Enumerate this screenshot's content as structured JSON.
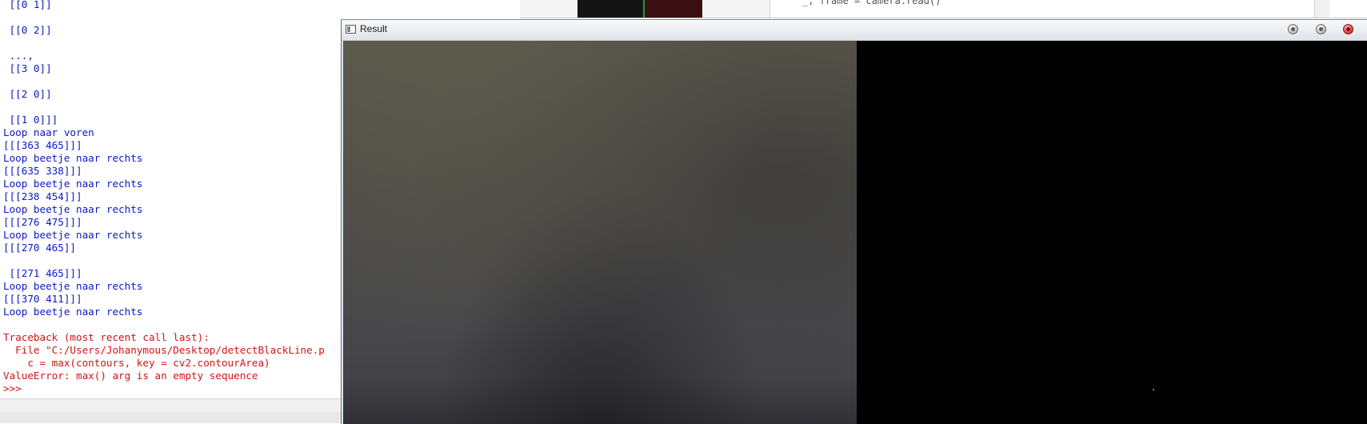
{
  "shell": {
    "output_lines": [
      {
        "text": " [[0 1]]",
        "kind": "stdout"
      },
      {
        "text": "",
        "kind": "stdout"
      },
      {
        "text": " [[0 2]]",
        "kind": "stdout"
      },
      {
        "text": "",
        "kind": "stdout"
      },
      {
        "text": " ...,",
        "kind": "stdout"
      },
      {
        "text": " [[3 0]]",
        "kind": "stdout"
      },
      {
        "text": "",
        "kind": "stdout"
      },
      {
        "text": " [[2 0]]",
        "kind": "stdout"
      },
      {
        "text": "",
        "kind": "stdout"
      },
      {
        "text": " [[1 0]]]",
        "kind": "stdout"
      },
      {
        "text": "Loop naar voren",
        "kind": "stdout"
      },
      {
        "text": "[[[363 465]]]",
        "kind": "stdout"
      },
      {
        "text": "Loop beetje naar rechts",
        "kind": "stdout"
      },
      {
        "text": "[[[635 338]]]",
        "kind": "stdout"
      },
      {
        "text": "Loop beetje naar rechts",
        "kind": "stdout"
      },
      {
        "text": "[[[238 454]]]",
        "kind": "stdout"
      },
      {
        "text": "Loop beetje naar rechts",
        "kind": "stdout"
      },
      {
        "text": "[[[276 475]]]",
        "kind": "stdout"
      },
      {
        "text": "Loop beetje naar rechts",
        "kind": "stdout"
      },
      {
        "text": "[[[270 465]]",
        "kind": "stdout"
      },
      {
        "text": "",
        "kind": "stdout"
      },
      {
        "text": " [[271 465]]]",
        "kind": "stdout"
      },
      {
        "text": "Loop beetje naar rechts",
        "kind": "stdout"
      },
      {
        "text": "[[[370 411]]]",
        "kind": "stdout"
      },
      {
        "text": "Loop beetje naar rechts",
        "kind": "stdout"
      },
      {
        "text": "",
        "kind": "stdout"
      },
      {
        "text": "Traceback (most recent call last):",
        "kind": "stderr"
      },
      {
        "text": "  File \"C:/Users/Johanymous/Desktop/detectBlackLine.p",
        "kind": "stderr"
      },
      {
        "text": "    c = max(contours, key = cv2.contourArea)",
        "kind": "stderr"
      },
      {
        "text": "ValueError: max() arg is an empty sequence",
        "kind": "stderr"
      },
      {
        "text": ">>>",
        "kind": "stderr"
      }
    ]
  },
  "background_editor": {
    "visible_code": "_, frame = camera.read()"
  },
  "result_window": {
    "title": "Result",
    "icon": "window-app-icon",
    "buttons": [
      {
        "name": "minimize",
        "icon": "minimize-button-icon"
      },
      {
        "name": "maximize",
        "icon": "maximize-button-icon"
      },
      {
        "name": "close",
        "icon": "close-button-icon"
      }
    ],
    "panes": [
      {
        "name": "camera-frame",
        "description_color": "#4f4e48"
      },
      {
        "name": "threshold-mask",
        "description_color": "#000000",
        "marker_color": "#19b34a"
      }
    ]
  },
  "colors": {
    "stdout": "#0b18c4",
    "stderr": "#d11414",
    "close_button": "#e0474a"
  }
}
